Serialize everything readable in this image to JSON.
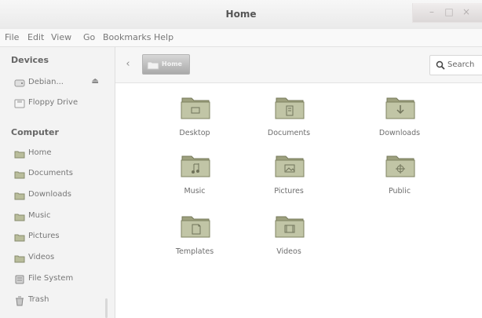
{
  "window": {
    "title": "Home"
  },
  "menu": {
    "items": [
      "File",
      "Edit",
      "View",
      "Go",
      "Bookmarks",
      "Help"
    ]
  },
  "sidebar": {
    "sections": [
      {
        "heading": "Devices",
        "items": [
          {
            "label": "Debian...",
            "icon": "drive-icon",
            "eject": "⏏"
          },
          {
            "label": "Floppy Drive",
            "icon": "floppy-icon"
          }
        ]
      },
      {
        "heading": "Computer",
        "items": [
          {
            "label": "Home",
            "icon": "home-folder-icon"
          },
          {
            "label": "Documents",
            "icon": "folder-icon"
          },
          {
            "label": "Downloads",
            "icon": "folder-icon"
          },
          {
            "label": "Music",
            "icon": "folder-icon"
          },
          {
            "label": "Pictures",
            "icon": "folder-icon"
          },
          {
            "label": "Videos",
            "icon": "folder-icon"
          },
          {
            "label": "File System",
            "icon": "file-system-icon"
          },
          {
            "label": "Trash",
            "icon": "trash-icon"
          }
        ]
      }
    ]
  },
  "toolbar": {
    "back_icon": "chevron-left-icon",
    "path_label": "Home",
    "search_label": "Search"
  },
  "files": [
    {
      "label": "Desktop",
      "icon": "desktop-folder-icon"
    },
    {
      "label": "Documents",
      "icon": "documents-folder-icon"
    },
    {
      "label": "Downloads",
      "icon": "downloads-folder-icon"
    },
    {
      "label": "Music",
      "icon": "music-folder-icon"
    },
    {
      "label": "Pictures",
      "icon": "pictures-folder-icon"
    },
    {
      "label": "Public",
      "icon": "public-folder-icon"
    },
    {
      "label": "Templates",
      "icon": "templates-folder-icon"
    },
    {
      "label": "Videos",
      "icon": "videos-folder-icon"
    }
  ],
  "colors": {
    "folder": "#b9bd9b",
    "folder_dark": "#8f9470",
    "sidebar_bg": "#f3f3f3",
    "main_bg": "#ffffff",
    "text": "#6d6d6d"
  }
}
